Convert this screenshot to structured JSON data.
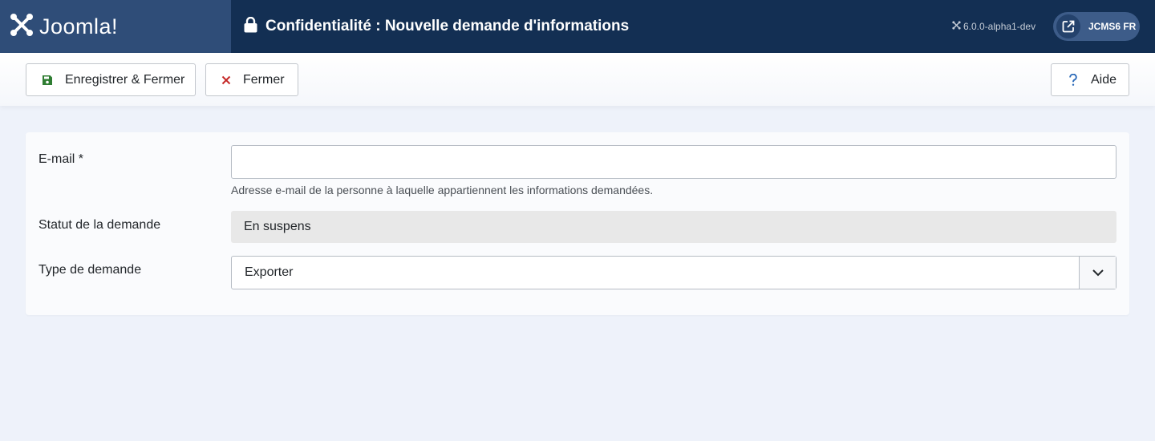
{
  "header": {
    "logo_text": "Joomla!",
    "page_title": "Confidentialité : Nouvelle demande d'informations",
    "version": "6.0.0-alpha1-dev",
    "site_label": "JCMS6 FR"
  },
  "toolbar": {
    "save_close_label": "Enregistrer & Fermer",
    "close_label": "Fermer",
    "help_label": "Aide"
  },
  "form": {
    "email": {
      "label": "E-mail *",
      "value": "",
      "hint": "Adresse e-mail de la personne à laquelle appartiennent les informations demandées."
    },
    "status": {
      "label": "Statut de la demande",
      "value": "En suspens"
    },
    "type": {
      "label": "Type de demande",
      "selected": "Exporter"
    }
  },
  "colors": {
    "header_bg": "#132f53",
    "logo_bg": "#2f4d78",
    "save_icon": "#2f7d32",
    "close_icon": "#c52827",
    "help_icon": "#2a69b8"
  },
  "icons": [
    "joomla-logo-icon",
    "lock-icon",
    "joomla-small-icon",
    "external-link-icon",
    "save-icon",
    "close-icon",
    "help-icon",
    "chevron-down-icon"
  ]
}
